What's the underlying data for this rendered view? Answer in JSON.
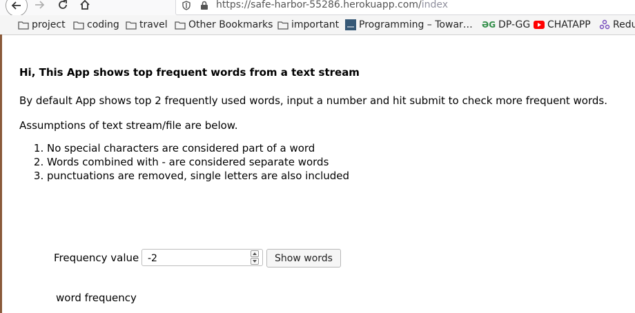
{
  "browser": {
    "url_main": "https://safe-harbor-55286.herokuapp.com/",
    "url_path": "index"
  },
  "bookmarks": [
    {
      "label": "project",
      "icon": "folder-icon"
    },
    {
      "label": "coding",
      "icon": "folder-icon"
    },
    {
      "label": "travel",
      "icon": "folder-icon"
    },
    {
      "label": "Other Bookmarks",
      "icon": "folder-icon"
    },
    {
      "label": "important",
      "icon": "folder-icon"
    },
    {
      "label": "Programming – Towar…",
      "icon": "towards-data-science-icon"
    },
    {
      "label": "DP-GG",
      "icon": "geeksforgeeks-icon"
    },
    {
      "label": "CHATAPP",
      "icon": "youtube-icon"
    },
    {
      "label": "Redu",
      "icon": "redux-icon"
    }
  ],
  "page": {
    "heading": "Hi, This App shows top frequent words from a text stream",
    "intro": "By default App shows top 2 frequently used words, input a number and hit submit to check more frequent words.",
    "assumptions_title": "Assumptions of text stream/file are below.",
    "rules": [
      "No special characters are considered part of a word",
      "Words combined with - are considered separate words",
      "punctuations are removed, single letters are also included"
    ],
    "freq_label": "Frequency value :",
    "freq_value": "-2",
    "button_label": "Show words",
    "result_header": "word frequency"
  },
  "colors": {
    "youtube": "#ff0000",
    "gfg": "#2f8d46",
    "redux": "#764abc",
    "tds": "#355876"
  }
}
